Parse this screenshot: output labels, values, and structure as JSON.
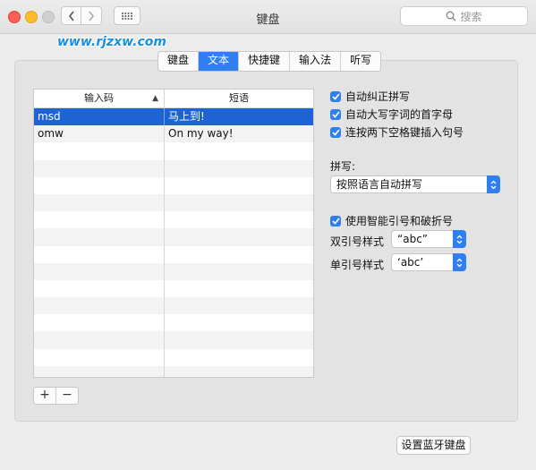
{
  "window": {
    "title": "键盘"
  },
  "search": {
    "placeholder": "搜索"
  },
  "watermark": "www.rjzxw.com",
  "tabs": [
    {
      "label": "键盘"
    },
    {
      "label": "文本",
      "active": true
    },
    {
      "label": "快捷键"
    },
    {
      "label": "输入法"
    },
    {
      "label": "听写"
    }
  ],
  "table": {
    "headers": {
      "input": "输入码",
      "phrase": "短语"
    },
    "rows": [
      {
        "input": "msd",
        "phrase": "马上到!",
        "selected": true
      },
      {
        "input": "omw",
        "phrase": "On my way!"
      }
    ]
  },
  "buttons": {
    "add": "+",
    "remove": "−",
    "bluetooth": "设置蓝牙键盘"
  },
  "options": {
    "autocorrect": "自动纠正拼写",
    "capitalize": "自动大写字词的首字母",
    "period": "连按两下空格键插入句号",
    "spelling_label": "拼写:",
    "spelling_value": "按照语言自动拼写",
    "smart_quotes": "使用智能引号和破折号",
    "double_label": "双引号样式",
    "double_value": "“abc”",
    "single_label": "单引号样式",
    "single_value": "‘abc’"
  },
  "colors": {
    "accent": "#2f7ff0",
    "selection": "#1d63d4"
  }
}
